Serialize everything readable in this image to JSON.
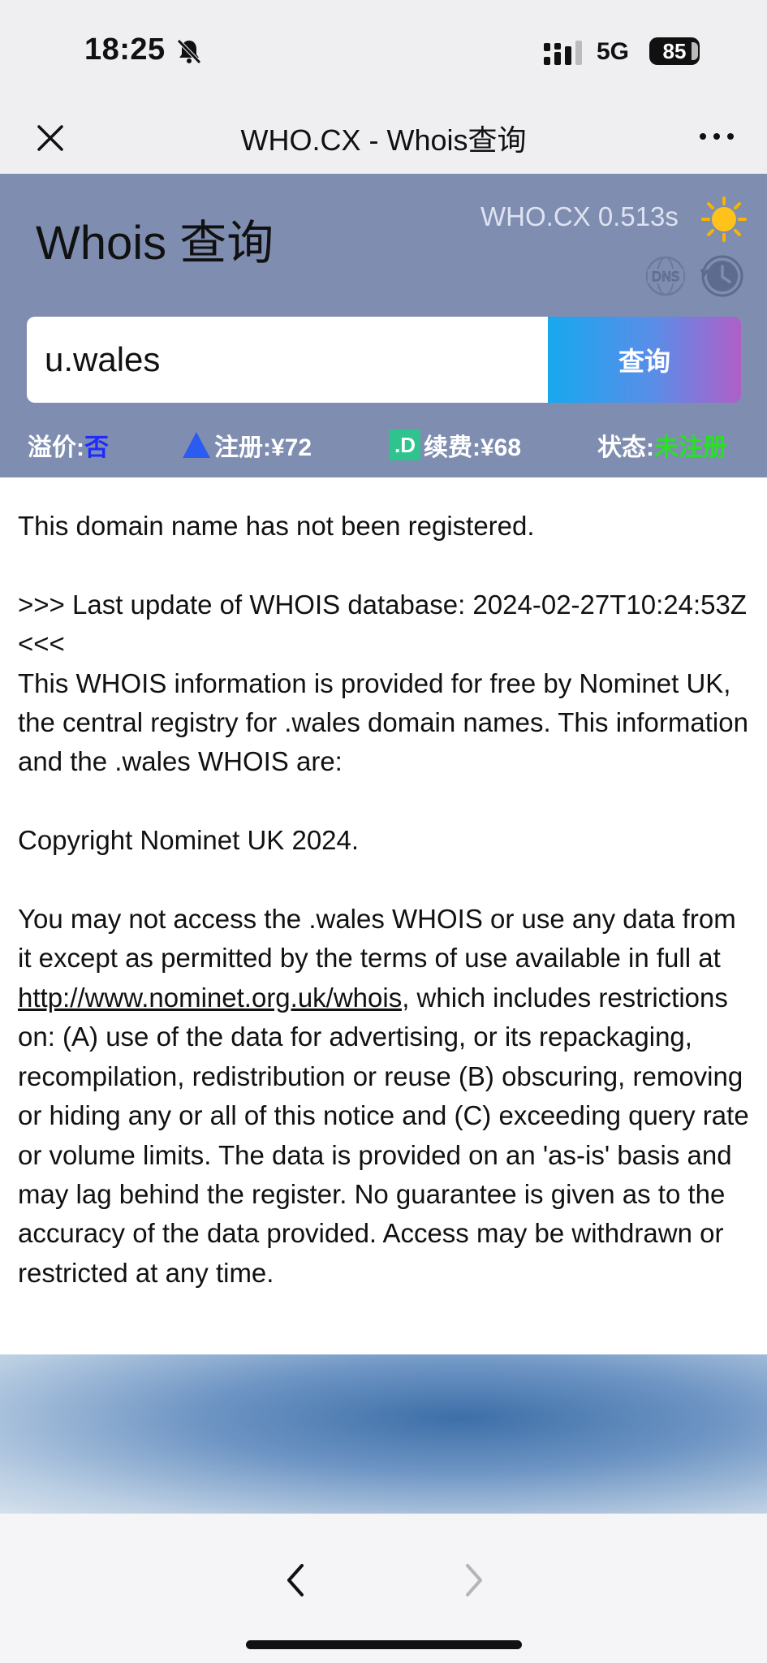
{
  "status_bar": {
    "time": "18:25",
    "network": "5G",
    "battery": "85"
  },
  "nav": {
    "title": "WHO.CX - Whois查询"
  },
  "header": {
    "title": "Whois 查询",
    "speed": "WHO.CX 0.513s",
    "dns_icon_label": "DNS"
  },
  "search": {
    "value": "u.wales",
    "button_label": "查询"
  },
  "info": {
    "premium_label": "溢价:",
    "premium_value": "否",
    "register_label": "注册:¥72",
    "renew_badge": ".D",
    "renew_label": "续费:¥68",
    "status_label": "状态:",
    "status_value": "未注册"
  },
  "whois": {
    "p1": "This domain name has not been registered.",
    "p2": ">>> Last update of WHOIS database: 2024-02-27T10:24:53Z <<<\nThis WHOIS information is provided for free by Nominet UK, the central registry for .wales domain names. This information and the .wales WHOIS are:",
    "p3": "Copyright Nominet UK 2024.",
    "p4_before": "You may not access the .wales WHOIS or use any data from it except as permitted by the terms of use available in full at ",
    "p4_link": "http://www.nominet.org.uk/whois,",
    "p4_after": " which includes restrictions on: (A) use of the data for advertising, or its repackaging, recompilation, redistribution or reuse (B) obscuring, removing or hiding any or all of this notice and (C) exceeding query rate or volume limits. The data is provided on an 'as-is' basis and may lag behind the register. No guarantee is given as to the accuracy of the data provided. Access may be withdrawn or restricted at any time."
  },
  "colors": {
    "header_bg": "#7f8db0",
    "premium_value": "#1e2bff",
    "status_value": "#28e025",
    "renew_badge": "#2fc48e"
  }
}
